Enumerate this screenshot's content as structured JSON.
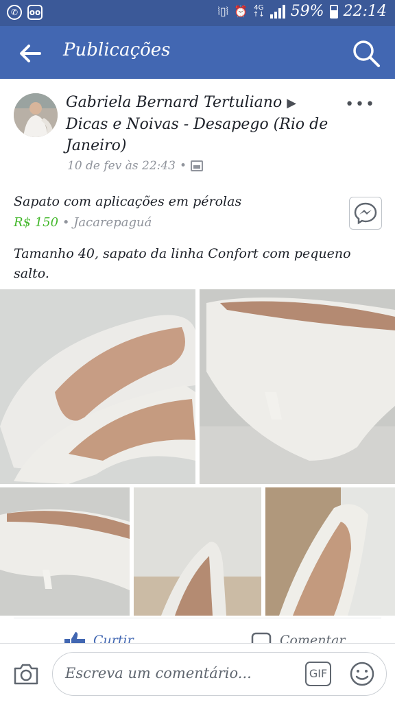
{
  "status_bar": {
    "time": "22:14",
    "battery": "59%",
    "network": "4G",
    "network_sub": "↑↓",
    "left_icons": [
      "whatsapp-icon",
      "voicemail-icon"
    ],
    "right_icons": [
      "vibrate-icon",
      "alarm-icon",
      "signal-icon",
      "battery-icon"
    ]
  },
  "app_bar": {
    "title": "Publicações",
    "bg_color": "#4267b2"
  },
  "post": {
    "author": "Gabriela Bernard Tertuliano",
    "group": "Dicas e Noivas - Desapego (Rio de Janeiro)",
    "arrow": "▶",
    "timestamp": "10 de fev às 22:43",
    "separator": "•",
    "more": "•••",
    "item_title": "Sapato com aplicações em pérolas",
    "price": "R$ 150",
    "location": "Jacarepaguá",
    "text": "Tamanho 40, sapato da linha Confort com pequeno salto.",
    "photo_count": 5
  },
  "actions": {
    "like": "Curtir",
    "comment": "Comentar"
  },
  "composer": {
    "placeholder": "Escreva um comentário...",
    "gif": "GIF"
  },
  "colors": {
    "status_bar": "#3b5998",
    "app_bar": "#4267b2",
    "price": "#42b72a",
    "meta": "#90949c"
  }
}
